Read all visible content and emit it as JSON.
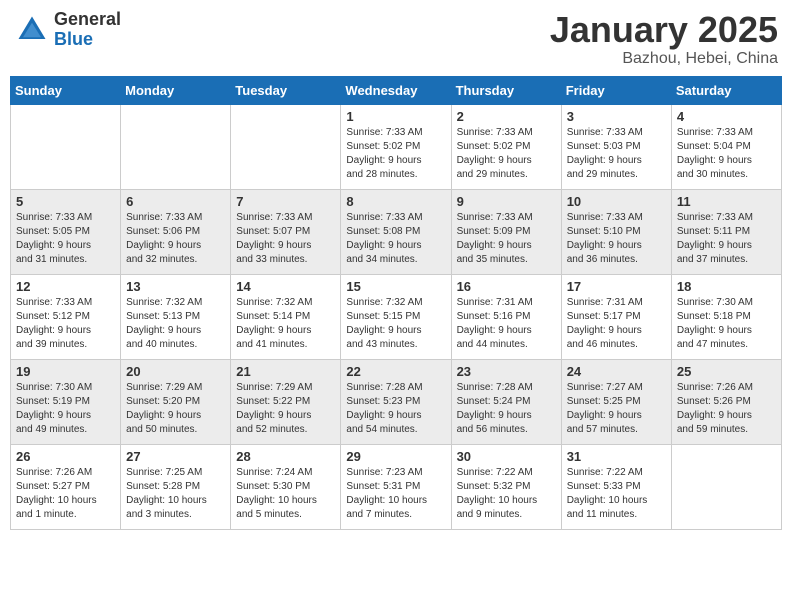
{
  "logo": {
    "general": "General",
    "blue": "Blue"
  },
  "title": "January 2025",
  "subtitle": "Bazhou, Hebei, China",
  "days_header": [
    "Sunday",
    "Monday",
    "Tuesday",
    "Wednesday",
    "Thursday",
    "Friday",
    "Saturday"
  ],
  "weeks": [
    [
      {
        "day": "",
        "info": ""
      },
      {
        "day": "",
        "info": ""
      },
      {
        "day": "",
        "info": ""
      },
      {
        "day": "1",
        "info": "Sunrise: 7:33 AM\nSunset: 5:02 PM\nDaylight: 9 hours\nand 28 minutes."
      },
      {
        "day": "2",
        "info": "Sunrise: 7:33 AM\nSunset: 5:02 PM\nDaylight: 9 hours\nand 29 minutes."
      },
      {
        "day": "3",
        "info": "Sunrise: 7:33 AM\nSunset: 5:03 PM\nDaylight: 9 hours\nand 29 minutes."
      },
      {
        "day": "4",
        "info": "Sunrise: 7:33 AM\nSunset: 5:04 PM\nDaylight: 9 hours\nand 30 minutes."
      }
    ],
    [
      {
        "day": "5",
        "info": "Sunrise: 7:33 AM\nSunset: 5:05 PM\nDaylight: 9 hours\nand 31 minutes."
      },
      {
        "day": "6",
        "info": "Sunrise: 7:33 AM\nSunset: 5:06 PM\nDaylight: 9 hours\nand 32 minutes."
      },
      {
        "day": "7",
        "info": "Sunrise: 7:33 AM\nSunset: 5:07 PM\nDaylight: 9 hours\nand 33 minutes."
      },
      {
        "day": "8",
        "info": "Sunrise: 7:33 AM\nSunset: 5:08 PM\nDaylight: 9 hours\nand 34 minutes."
      },
      {
        "day": "9",
        "info": "Sunrise: 7:33 AM\nSunset: 5:09 PM\nDaylight: 9 hours\nand 35 minutes."
      },
      {
        "day": "10",
        "info": "Sunrise: 7:33 AM\nSunset: 5:10 PM\nDaylight: 9 hours\nand 36 minutes."
      },
      {
        "day": "11",
        "info": "Sunrise: 7:33 AM\nSunset: 5:11 PM\nDaylight: 9 hours\nand 37 minutes."
      }
    ],
    [
      {
        "day": "12",
        "info": "Sunrise: 7:33 AM\nSunset: 5:12 PM\nDaylight: 9 hours\nand 39 minutes."
      },
      {
        "day": "13",
        "info": "Sunrise: 7:32 AM\nSunset: 5:13 PM\nDaylight: 9 hours\nand 40 minutes."
      },
      {
        "day": "14",
        "info": "Sunrise: 7:32 AM\nSunset: 5:14 PM\nDaylight: 9 hours\nand 41 minutes."
      },
      {
        "day": "15",
        "info": "Sunrise: 7:32 AM\nSunset: 5:15 PM\nDaylight: 9 hours\nand 43 minutes."
      },
      {
        "day": "16",
        "info": "Sunrise: 7:31 AM\nSunset: 5:16 PM\nDaylight: 9 hours\nand 44 minutes."
      },
      {
        "day": "17",
        "info": "Sunrise: 7:31 AM\nSunset: 5:17 PM\nDaylight: 9 hours\nand 46 minutes."
      },
      {
        "day": "18",
        "info": "Sunrise: 7:30 AM\nSunset: 5:18 PM\nDaylight: 9 hours\nand 47 minutes."
      }
    ],
    [
      {
        "day": "19",
        "info": "Sunrise: 7:30 AM\nSunset: 5:19 PM\nDaylight: 9 hours\nand 49 minutes."
      },
      {
        "day": "20",
        "info": "Sunrise: 7:29 AM\nSunset: 5:20 PM\nDaylight: 9 hours\nand 50 minutes."
      },
      {
        "day": "21",
        "info": "Sunrise: 7:29 AM\nSunset: 5:22 PM\nDaylight: 9 hours\nand 52 minutes."
      },
      {
        "day": "22",
        "info": "Sunrise: 7:28 AM\nSunset: 5:23 PM\nDaylight: 9 hours\nand 54 minutes."
      },
      {
        "day": "23",
        "info": "Sunrise: 7:28 AM\nSunset: 5:24 PM\nDaylight: 9 hours\nand 56 minutes."
      },
      {
        "day": "24",
        "info": "Sunrise: 7:27 AM\nSunset: 5:25 PM\nDaylight: 9 hours\nand 57 minutes."
      },
      {
        "day": "25",
        "info": "Sunrise: 7:26 AM\nSunset: 5:26 PM\nDaylight: 9 hours\nand 59 minutes."
      }
    ],
    [
      {
        "day": "26",
        "info": "Sunrise: 7:26 AM\nSunset: 5:27 PM\nDaylight: 10 hours\nand 1 minute."
      },
      {
        "day": "27",
        "info": "Sunrise: 7:25 AM\nSunset: 5:28 PM\nDaylight: 10 hours\nand 3 minutes."
      },
      {
        "day": "28",
        "info": "Sunrise: 7:24 AM\nSunset: 5:30 PM\nDaylight: 10 hours\nand 5 minutes."
      },
      {
        "day": "29",
        "info": "Sunrise: 7:23 AM\nSunset: 5:31 PM\nDaylight: 10 hours\nand 7 minutes."
      },
      {
        "day": "30",
        "info": "Sunrise: 7:22 AM\nSunset: 5:32 PM\nDaylight: 10 hours\nand 9 minutes."
      },
      {
        "day": "31",
        "info": "Sunrise: 7:22 AM\nSunset: 5:33 PM\nDaylight: 10 hours\nand 11 minutes."
      },
      {
        "day": "",
        "info": ""
      }
    ]
  ]
}
